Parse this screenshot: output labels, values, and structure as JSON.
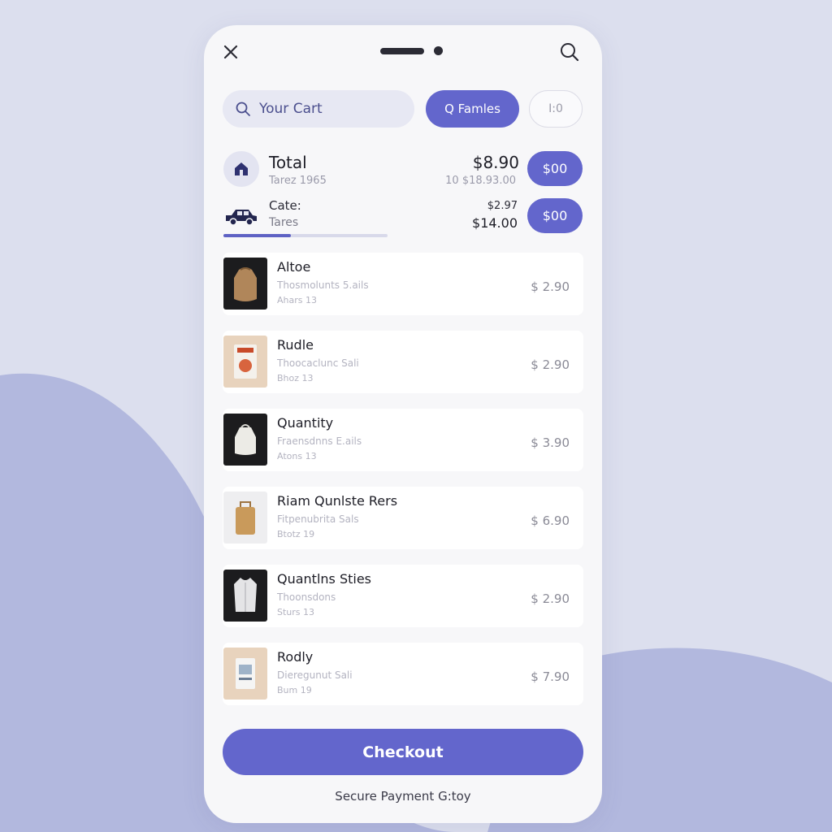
{
  "colors": {
    "accent": "#6366cc",
    "background": "#dcdfee",
    "wave": "#b2b8de",
    "panel": "#f7f7f9"
  },
  "topbar": {
    "close_icon": "close-icon",
    "search_icon": "search-icon"
  },
  "search": {
    "placeholder": "Your Cart",
    "icon": "search-icon"
  },
  "filters": {
    "primary_label": "Q Famles",
    "secondary_label": "I:0"
  },
  "summary": {
    "title": "Total",
    "subtitle": "Tarez 1965",
    "amount": "$8.90",
    "amount_sub": "10 $18.93.00",
    "button_label": "$00",
    "shipping_title": "Cate:",
    "shipping_sub": "Tares",
    "shipping_amount_1": "$2.97",
    "shipping_amount_2": "$14.00",
    "shipping_button_label": "$00",
    "progress": 0.41
  },
  "items": [
    {
      "name": "Altoe",
      "desc": "Thosmolunts 5.ails",
      "meta": "Ahars 13",
      "price": "$ 2.90",
      "thumb": "bag-product"
    },
    {
      "name": "Rudle",
      "desc": "Thoocaclunc Sali",
      "meta": "Bhoz 13",
      "price": "$ 2.90",
      "thumb": "box-product"
    },
    {
      "name": "Quantity",
      "desc": "Fraensdnns E.ails",
      "meta": "Atons 13",
      "price": "$ 3.90",
      "thumb": "white-bag-product"
    },
    {
      "name": "Riam Qunlste Rers",
      "desc": "Fitpenubrita Sals",
      "meta": "Btotz 19",
      "price": "$ 6.90",
      "thumb": "tan-bag-product"
    },
    {
      "name": "Quantlns Sties",
      "desc": "Thoonsdons",
      "meta": "Sturs 13",
      "price": "$ 2.90",
      "thumb": "shirt-product"
    },
    {
      "name": "Rodly",
      "desc": "Dieregunut Sali",
      "meta": "Bum 19",
      "price": "$ 7.90",
      "thumb": "pack-product"
    }
  ],
  "checkout": {
    "label": "Checkout"
  },
  "footer": {
    "note": "Secure Payment G:toy"
  }
}
